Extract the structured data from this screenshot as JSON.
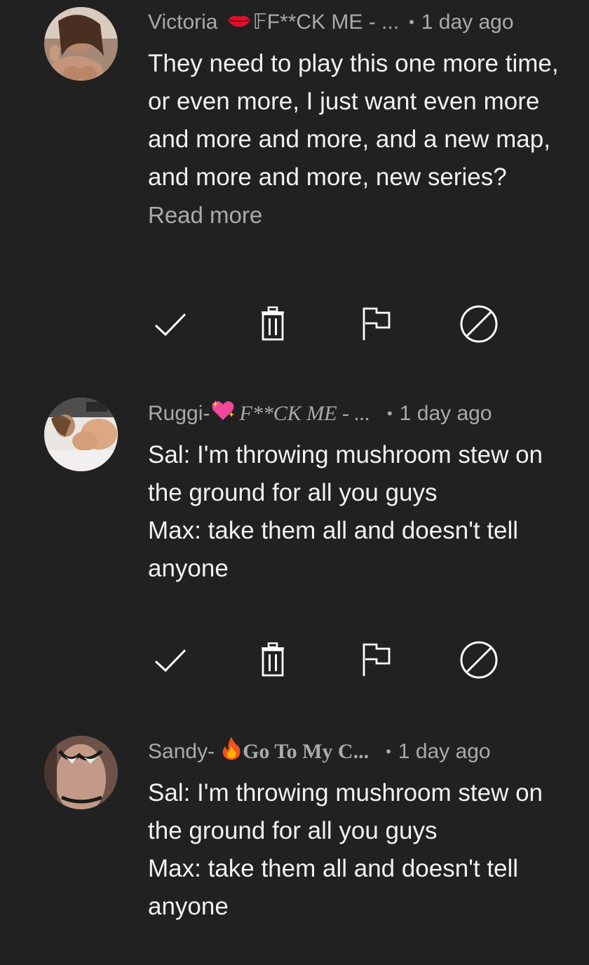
{
  "comments": [
    {
      "author": "Victoria",
      "badge_icon": "lips-icon",
      "tagline": "𝔽F**CK ME - ...",
      "time": "1 day ago",
      "text": "They need to play this one more time, or even more, I just want even more and more and more, and a new map, and more and more, new series?",
      "read_more": "Read more",
      "avatar_colors": [
        "#9a7a6a",
        "#d8c8bc",
        "#5c4036"
      ]
    },
    {
      "author": "Ruggi-",
      "badge_icon": "sparkling-heart-icon",
      "tagline": "F**CK ME - ...",
      "time": "1 day ago",
      "text": "Sal: I'm throwing mushroom stew on the ground for all you guys\nMax: take them all and doesn't tell anyone",
      "avatar_colors": [
        "#e8e4e0",
        "#d9a57f",
        "#6a6a6a"
      ]
    },
    {
      "author": "Sandy-",
      "badge_icon": "fire-icon",
      "tagline": "Go To My C...",
      "time": "1 day ago",
      "text": "Sal: I'm throwing mushroom stew on the ground for all you guys\nMax: take them all and doesn't tell anyone",
      "avatar_colors": [
        "#8a6658",
        "#c9a090",
        "#2a2020"
      ]
    }
  ],
  "actions": [
    {
      "icon": "check-icon",
      "label": "Approve"
    },
    {
      "icon": "trash-icon",
      "label": "Remove"
    },
    {
      "icon": "flag-icon",
      "label": "Report"
    },
    {
      "icon": "block-icon",
      "label": "Hide user"
    }
  ],
  "colors": {
    "background": "#212121",
    "text": "#f1f1f1",
    "secondary_text": "#aaaaaa",
    "icon": "#ffffff"
  }
}
